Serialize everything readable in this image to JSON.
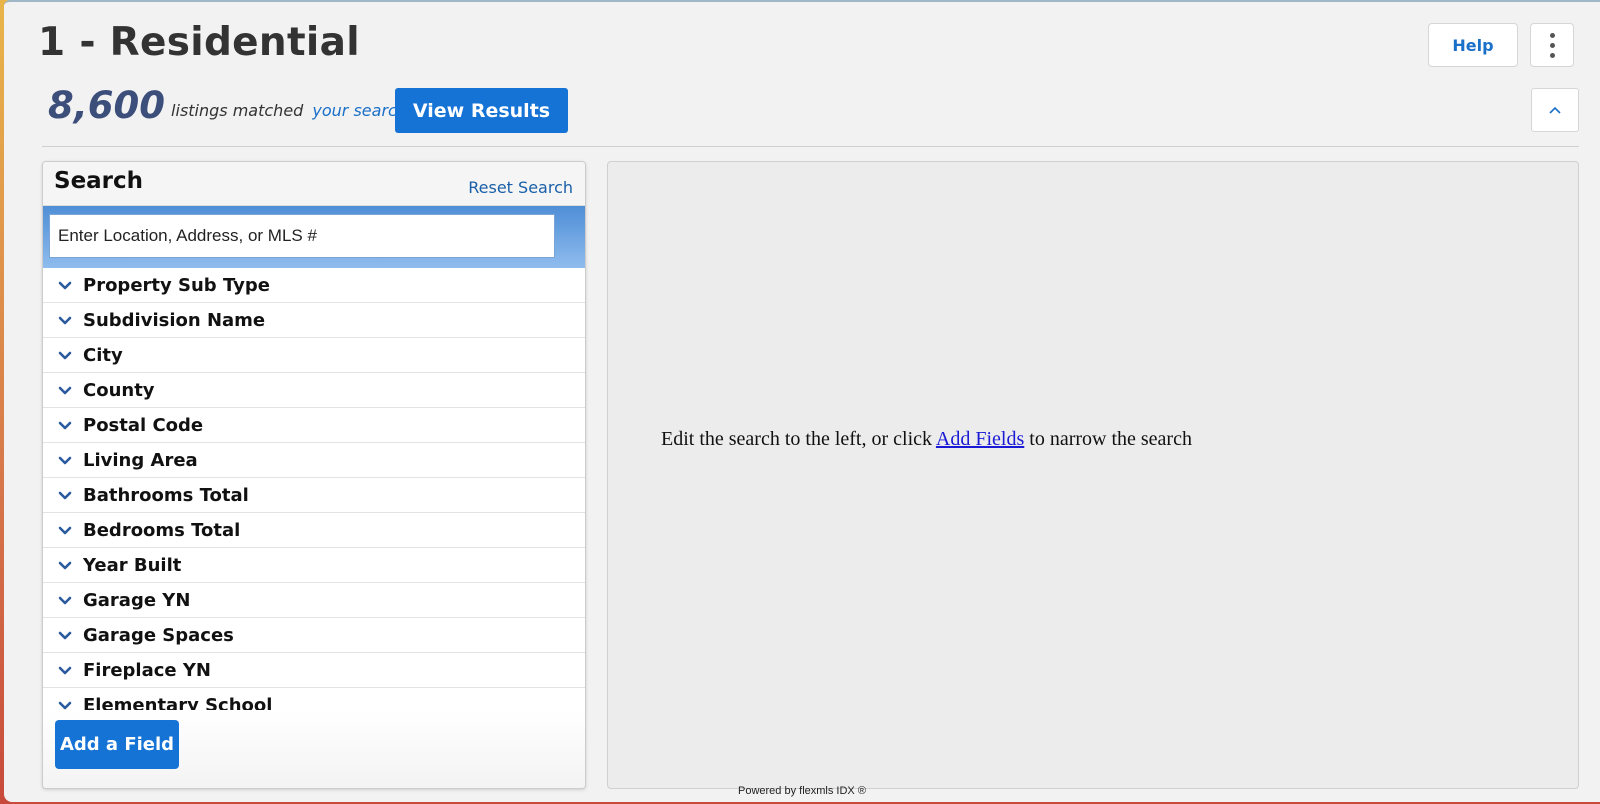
{
  "header": {
    "title": "1 - Residential",
    "help_label": "Help",
    "more_icon": "vertical-ellipsis-icon",
    "collapse_icon": "chevron-up-icon"
  },
  "summary": {
    "count": "8,600",
    "matched_text": "listings matched",
    "your_search_link": "your search",
    "view_results_label": "View Results"
  },
  "search": {
    "title": "Search",
    "reset_label": "Reset Search",
    "location_placeholder": "Enter Location, Address, or MLS #",
    "fields": [
      {
        "label": "Property Sub Type"
      },
      {
        "label": "Subdivision Name"
      },
      {
        "label": "City"
      },
      {
        "label": "County"
      },
      {
        "label": "Postal Code"
      },
      {
        "label": "Living Area"
      },
      {
        "label": "Bathrooms Total"
      },
      {
        "label": "Bedrooms Total"
      },
      {
        "label": "Year Built"
      },
      {
        "label": "Garage YN"
      },
      {
        "label": "Garage Spaces"
      },
      {
        "label": "Fireplace YN"
      },
      {
        "label": "Elementary School"
      }
    ],
    "add_field_label": "Add a Field"
  },
  "results": {
    "msg_before": "Edit the search to the left, or click",
    "add_fields_link": "Add Fields",
    "msg_after": "to narrow the search"
  },
  "footer": {
    "powered_by": "Powered by flexmls IDX ®"
  },
  "colors": {
    "primary_button": "#1573d6",
    "link": "#1a6fc9",
    "count": "#3c4e7a"
  }
}
